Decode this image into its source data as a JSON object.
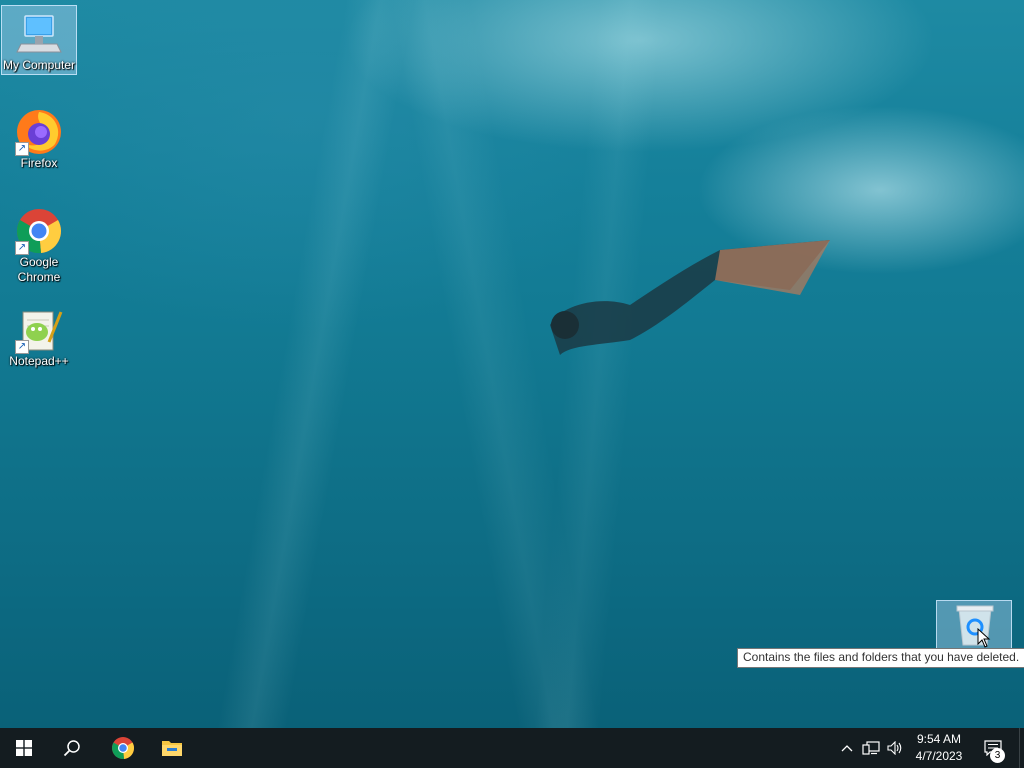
{
  "desktop": {
    "icons": [
      {
        "label": "My Computer"
      },
      {
        "label": "Firefox"
      },
      {
        "label": "Google Chrome"
      },
      {
        "label": "Notepad++"
      }
    ],
    "recycle_bin_tooltip": "Contains the files and folders that you have deleted."
  },
  "taskbar": {
    "pinned": [
      "start-icon",
      "search-icon",
      "chrome-icon",
      "file-explorer-icon"
    ],
    "tray": [
      "chevron-up-icon",
      "network-icon",
      "volume-icon"
    ],
    "clock": {
      "time": "9:54 AM",
      "date": "4/7/2023"
    },
    "notification_count": "3"
  },
  "colors": {
    "taskbar_bg": "#141c20",
    "windows_blue": "#1e90ff",
    "selection": "#aad2f0"
  }
}
